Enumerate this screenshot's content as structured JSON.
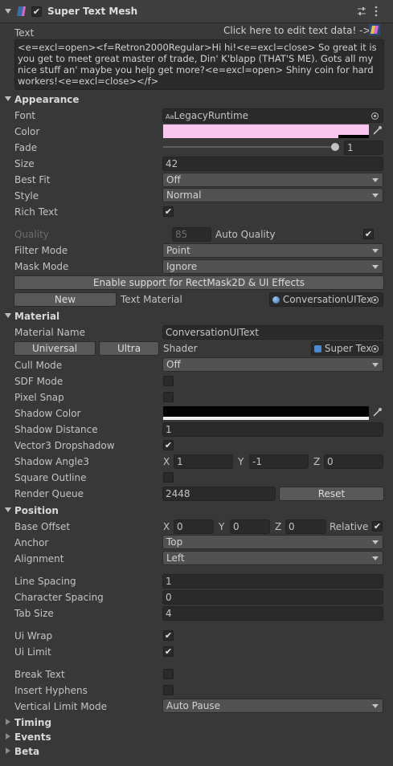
{
  "header": {
    "title": "Super Text Mesh",
    "enabled": true
  },
  "text_section": {
    "label": "Text",
    "edit_link": "Click here to edit text data! ->",
    "value": "<e=excl=open><f=Retron2000Regular>Hi hi!<e=excl=close> So great it is you get to meet great master of trade, Din' K'blapp (THAT'S ME). Gots all my nice stuff an' maybe you help get more?<e=excl=open> Shiny coin for hard workers!<e=excl=close></f>"
  },
  "appearance": {
    "title": "Appearance",
    "font_label": "Font",
    "font_value": "LegacyRuntime",
    "font_badge": "Aa",
    "color_label": "Color",
    "color_value": "#f9c6f0",
    "fade_label": "Fade",
    "fade_value": "1",
    "fade_fraction": 1,
    "size_label": "Size",
    "size_value": "42",
    "bestfit_label": "Best Fit",
    "bestfit_value": "Off",
    "style_label": "Style",
    "style_value": "Normal",
    "richtext_label": "Rich Text",
    "richtext_checked": true,
    "quality_label": "Quality",
    "quality_value": "85",
    "autoquality_label": "Auto Quality",
    "autoquality_checked": true,
    "filter_label": "Filter Mode",
    "filter_value": "Point",
    "mask_label": "Mask Mode",
    "mask_value": "Ignore",
    "rectmask_button": "Enable support for RectMask2D & UI Effects",
    "new_button": "New",
    "text_material_label": "Text Material",
    "text_material_value": "ConversationUITex"
  },
  "material": {
    "title": "Material",
    "name_label": "Material Name",
    "name_value": "ConversationUIText",
    "universal_button": "Universal",
    "ultra_button": "Ultra",
    "shader_label": "Shader",
    "shader_value": "Super Tex",
    "cull_label": "Cull Mode",
    "cull_value": "Off",
    "sdf_label": "SDF Mode",
    "sdf_checked": false,
    "pixelsnap_label": "Pixel Snap",
    "pixelsnap_checked": false,
    "shadowcolor_label": "Shadow Color",
    "shadowcolor_value": "#000000",
    "shadowdist_label": "Shadow Distance",
    "shadowdist_value": "1",
    "v3drop_label": "Vector3 Dropshadow",
    "v3drop_checked": true,
    "shadowangle_label": "Shadow Angle3",
    "angle_x_label": "X",
    "angle_x": "1",
    "angle_y_label": "Y",
    "angle_y": "-1",
    "angle_z_label": "Z",
    "angle_z": "0",
    "squareoutline_label": "Square Outline",
    "squareoutline_checked": false,
    "renderqueue_label": "Render Queue",
    "renderqueue_value": "2448",
    "reset_button": "Reset"
  },
  "position": {
    "title": "Position",
    "baseoffset_label": "Base Offset",
    "off_x_label": "X",
    "off_x": "0",
    "off_y_label": "Y",
    "off_y": "0",
    "off_z_label": "Z",
    "off_z": "0",
    "relative_label": "Relative",
    "relative_checked": true,
    "anchor_label": "Anchor",
    "anchor_value": "Top",
    "alignment_label": "Alignment",
    "alignment_value": "Left",
    "linespacing_label": "Line Spacing",
    "linespacing_value": "1",
    "charspacing_label": "Character Spacing",
    "charspacing_value": "0",
    "tabsize_label": "Tab Size",
    "tabsize_value": "4",
    "uiwrap_label": "Ui Wrap",
    "uiwrap_checked": true,
    "uilimit_label": "Ui Limit",
    "uilimit_checked": true,
    "breaktext_label": "Break Text",
    "breaktext_checked": false,
    "hyphens_label": "Insert Hyphens",
    "hyphens_checked": false,
    "vlimit_label": "Vertical Limit Mode",
    "vlimit_value": "Auto Pause"
  },
  "collapsed_sections": [
    "Timing",
    "Events",
    "Beta"
  ],
  "check_glyph": "✔",
  "icons": [
    "script-icon",
    "sliders-icon",
    "kebab-menu-icon",
    "edit-text-icon",
    "object-picker-icon",
    "eyedropper-icon",
    "material-icon"
  ]
}
